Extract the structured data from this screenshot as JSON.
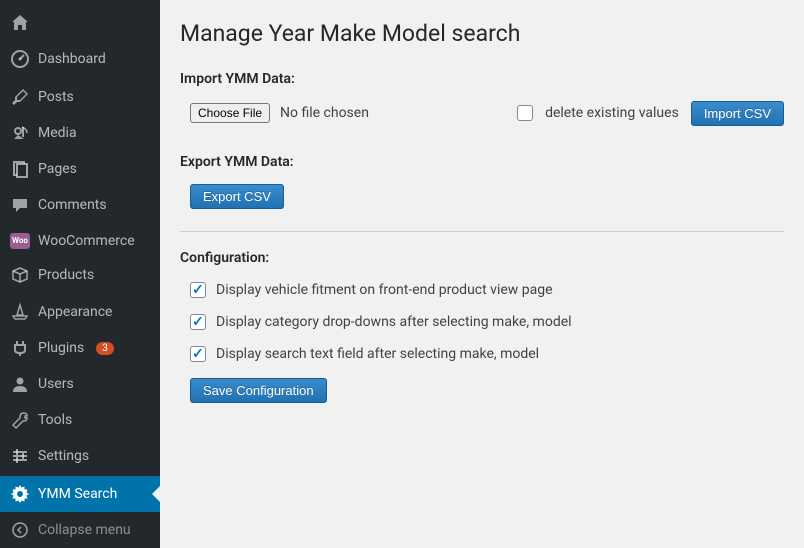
{
  "sidebar": {
    "items": [
      {
        "icon": "home",
        "label": ""
      },
      {
        "icon": "dashboard",
        "label": "Dashboard"
      },
      {
        "icon": "pin",
        "label": "Posts"
      },
      {
        "icon": "media",
        "label": "Media"
      },
      {
        "icon": "page",
        "label": "Pages"
      },
      {
        "icon": "comment",
        "label": "Comments"
      },
      {
        "icon": "woo",
        "label": "WooCommerce"
      },
      {
        "icon": "products",
        "label": "Products"
      },
      {
        "icon": "appearance",
        "label": "Appearance"
      },
      {
        "icon": "plugins",
        "label": "Plugins",
        "badge": "3"
      },
      {
        "icon": "users",
        "label": "Users"
      },
      {
        "icon": "tools",
        "label": "Tools"
      },
      {
        "icon": "settings",
        "label": "Settings"
      },
      {
        "icon": "gear",
        "label": "YMM Search"
      },
      {
        "icon": "collapse",
        "label": "Collapse menu"
      }
    ]
  },
  "page": {
    "title": "Manage Year Make Model search",
    "import_label": "Import YMM Data:",
    "choose_file": "Choose File",
    "no_file": "No file chosen",
    "delete_existing": "delete existing values",
    "import_btn": "Import CSV",
    "export_label": "Export YMM Data:",
    "export_btn": "Export CSV",
    "config_label": "Configuration:",
    "cfg1": "Display vehicle fitment on front-end product view page",
    "cfg2": "Display category drop-downs after selecting make, model",
    "cfg3": "Display search text field after selecting make, model",
    "save_btn": "Save Configuration"
  }
}
